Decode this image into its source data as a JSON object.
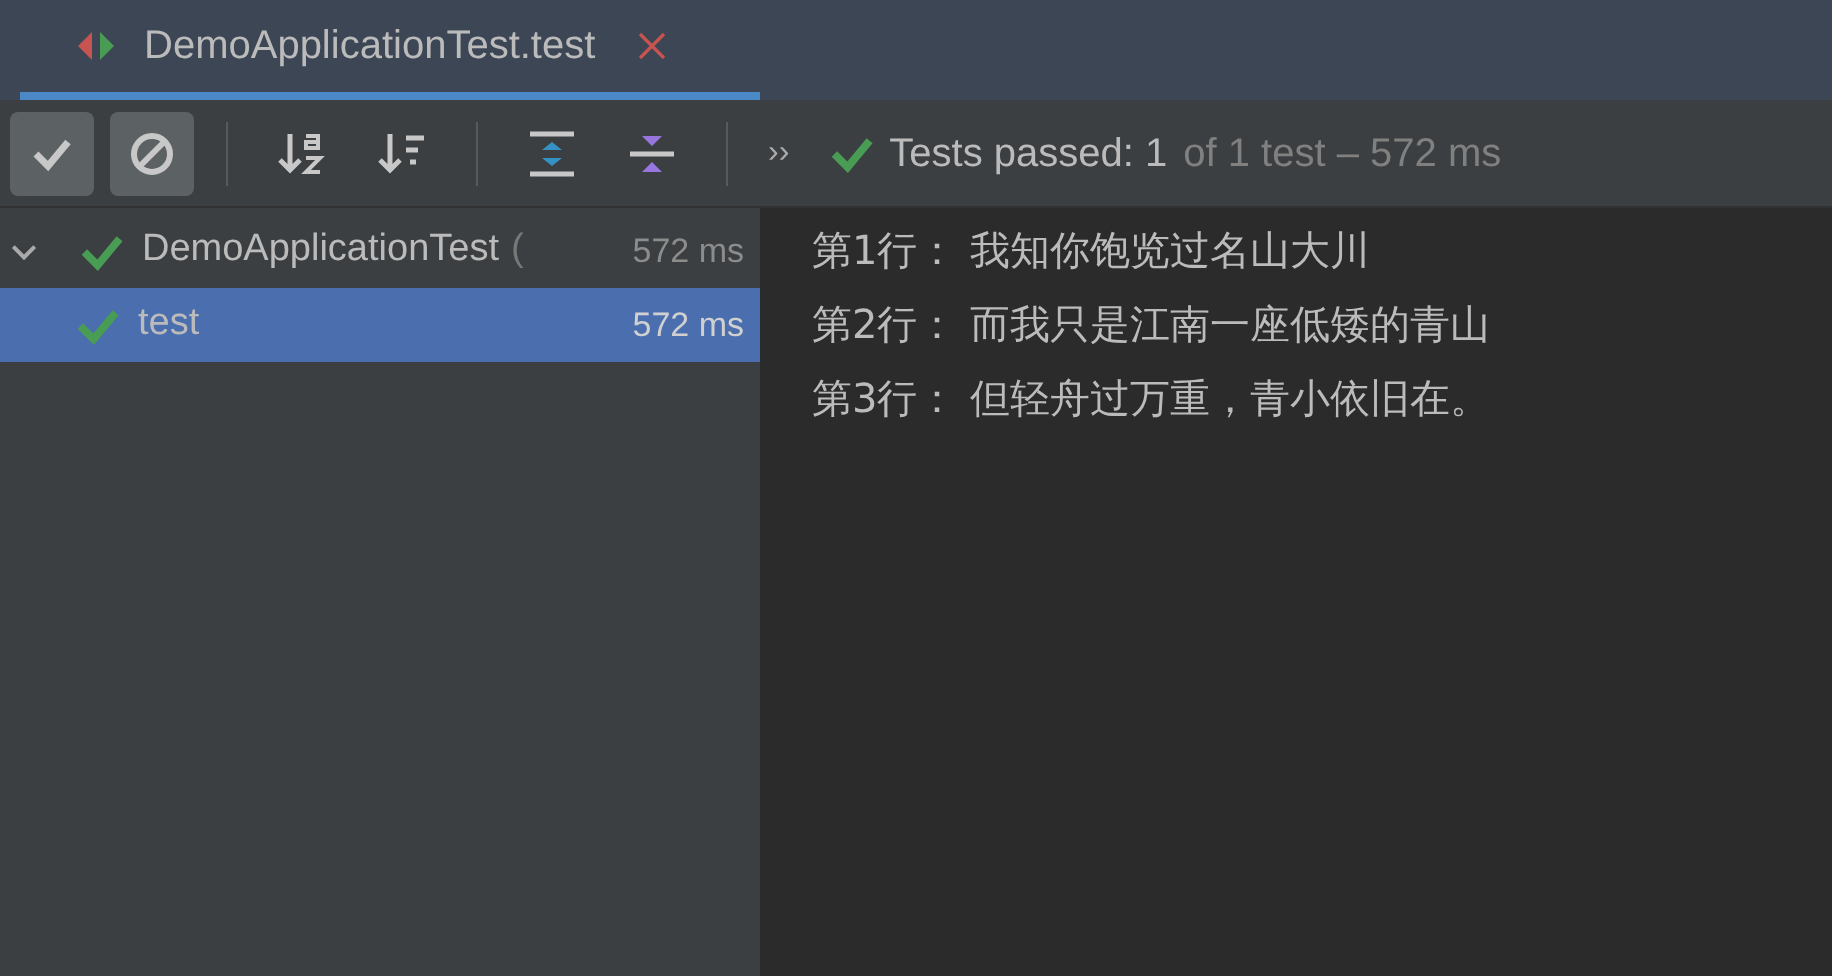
{
  "tab": {
    "title": "DemoApplicationTest.test",
    "selected": true
  },
  "toolbar": {
    "toggles": [
      {
        "kind": "passed",
        "on": true
      },
      {
        "kind": "ignored",
        "on": true
      }
    ],
    "overflow": "››"
  },
  "status": {
    "summary": "Tests passed: 1",
    "detail": "of 1 test – 572 ms"
  },
  "tree": [
    {
      "name": "DemoApplicationTest",
      "cut": "(",
      "duration": "572 ms",
      "expanded": true,
      "selected": false,
      "children": [
        {
          "name": "test",
          "duration": "572 ms",
          "selected": true
        }
      ]
    }
  ],
  "console": [
    "第1行： 我知你饱览过名山大川",
    "第2行： 而我只是江南一座低矮的青山",
    "第3行： 但轻舟过万重，青小依旧在。"
  ]
}
